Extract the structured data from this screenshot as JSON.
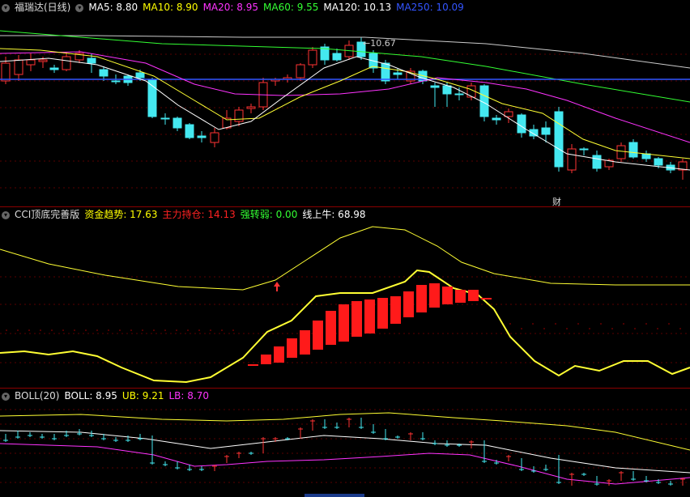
{
  "main": {
    "name": "福瑞达(日线)",
    "ma": [
      {
        "label": "MA5: 8.80",
        "color": "#ffffff"
      },
      {
        "label": "MA10: 8.90",
        "color": "#ffff00"
      },
      {
        "label": "MA20: 8.95",
        "color": "#ff33ff"
      },
      {
        "label": "MA60: 9.55",
        "color": "#33ff33"
      },
      {
        "label": "MA120: 10.13",
        "color": "#ffffff"
      },
      {
        "label": "MA250: 10.09",
        "color": "#3355ff"
      }
    ],
    "high_label": "10.67",
    "event_tag": "财"
  },
  "cci": {
    "name": "CCI顶底完善版",
    "items": [
      {
        "label": "资金趋势: 17.63",
        "color": "#ffff00"
      },
      {
        "label": "主力持仓: 14.13",
        "color": "#ff2222"
      },
      {
        "label": "强转弱: 0.00",
        "color": "#33ff33"
      },
      {
        "label": "线上牛: 68.98",
        "color": "#ffffff"
      }
    ]
  },
  "boll": {
    "name": "BOLL(20)",
    "items": [
      {
        "label": "BOLL: 8.95",
        "color": "#ffffff"
      },
      {
        "label": "UB: 9.21",
        "color": "#ffff00"
      },
      {
        "label": "LB: 8.70",
        "color": "#ff33ff"
      }
    ]
  }
}
